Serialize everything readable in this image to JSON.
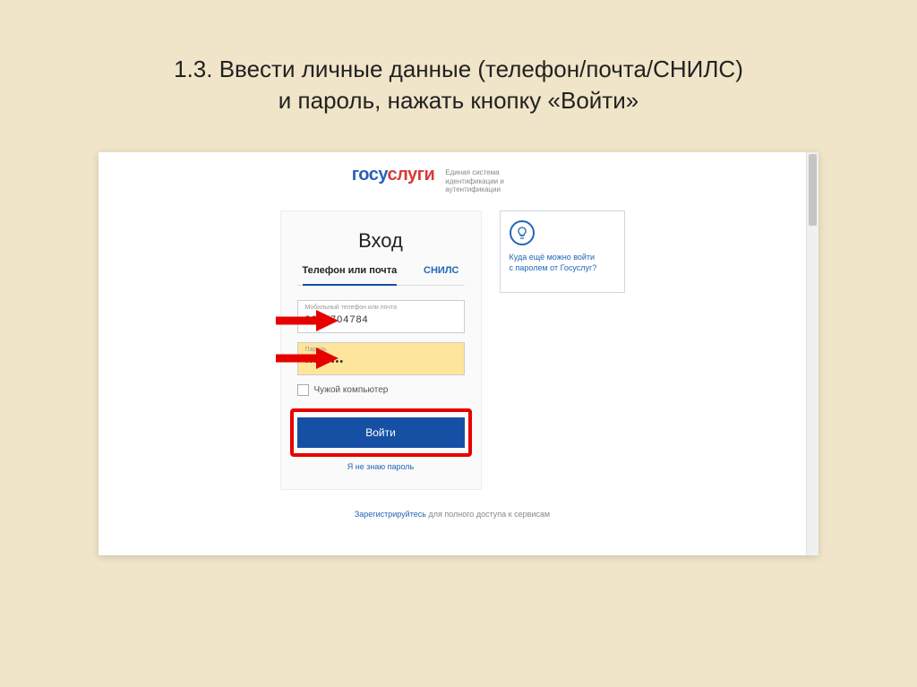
{
  "slide": {
    "title_line1": "1.3. Ввести личные данные (телефон/почта/СНИЛС)",
    "title_line2": "и пароль, нажать кнопку «Войти»"
  },
  "logo": {
    "part1": "госу",
    "part2": "слуги"
  },
  "tagline": {
    "line1": "Единая система",
    "line2": "идентификации и аутентификации"
  },
  "login": {
    "heading": "Вход",
    "tab_phone": "Телефон или почта",
    "tab_snils": "СНИЛС",
    "field_login_label": "Мобильный телефон или почта",
    "field_login_value": "9637704784",
    "field_password_label": "Пароль",
    "field_password_value": "•••••••••",
    "checkbox_label": "Чужой компьютер",
    "submit": "Войти",
    "forgot": "Я не знаю пароль"
  },
  "info": {
    "line1": "Куда ещё можно войти",
    "line2": "с паролем от Госуслуг?"
  },
  "register": {
    "link": "Зарегистрируйтесь",
    "rest": " для полного доступа к сервисам"
  }
}
